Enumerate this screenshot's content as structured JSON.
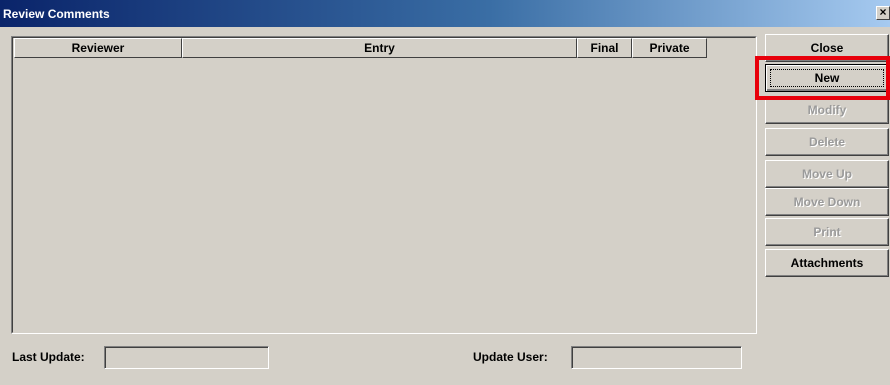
{
  "window": {
    "title": "Review Comments",
    "close_glyph": "×"
  },
  "table": {
    "columns": [
      "Reviewer",
      "Entry",
      "Final",
      "Private"
    ],
    "rows": []
  },
  "buttons": {
    "close": "Close",
    "new": "New",
    "modify": "Modify",
    "delete": "Delete",
    "move_up": "Move Up",
    "move_down": "Move Down",
    "print": "Print",
    "attachments": "Attachments"
  },
  "footer": {
    "last_update_label": "Last Update:",
    "last_update_value": "",
    "update_user_label": "Update User:",
    "update_user_value": ""
  },
  "highlight_color": "#e8000b"
}
